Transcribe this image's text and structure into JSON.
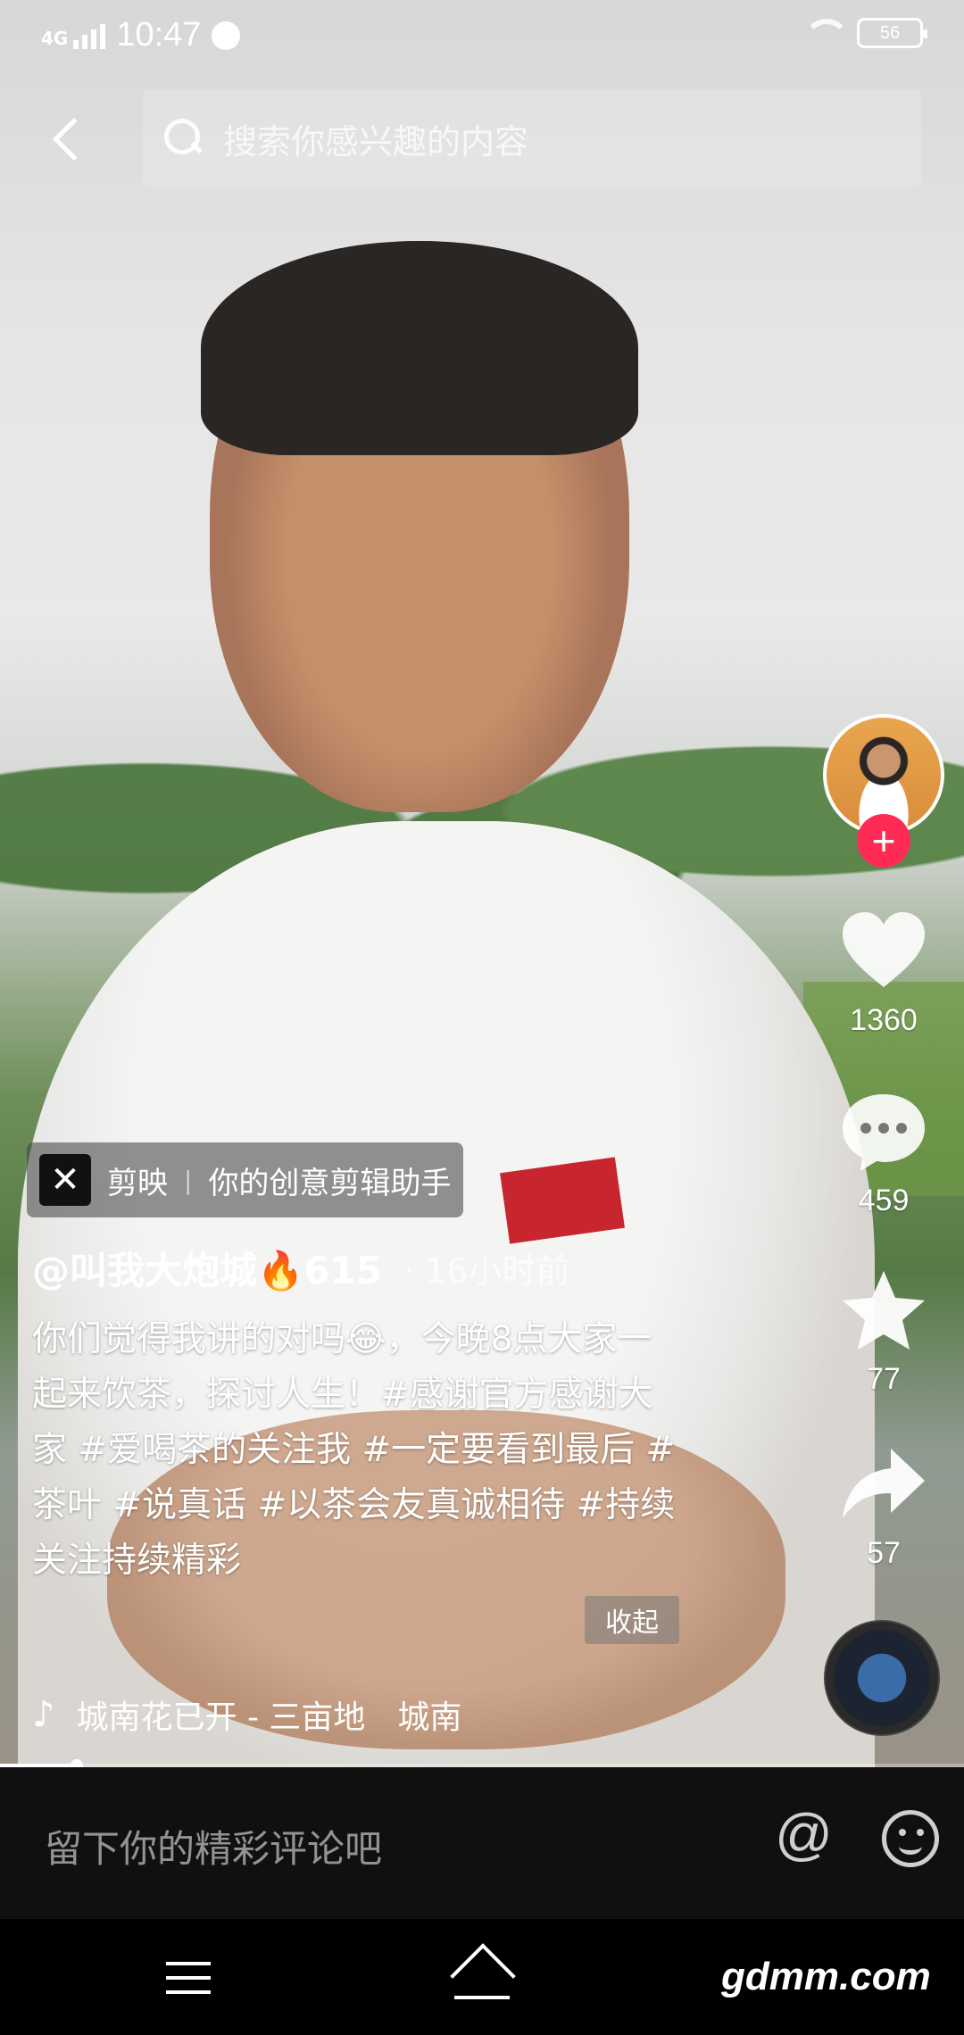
{
  "status_bar": {
    "network": "4G",
    "time": "10:47",
    "battery": "56"
  },
  "search": {
    "placeholder": "搜索你感兴趣的内容"
  },
  "rail": {
    "likes": "1360",
    "comments": "459",
    "favorites": "77",
    "shares": "57",
    "follow_symbol": "+"
  },
  "capcut": {
    "brand": "剪映",
    "separator": "|",
    "slogan": "你的创意剪辑助手"
  },
  "post": {
    "author": "@叫我大炮城🔥615",
    "time_ago": "· 16小时前",
    "caption": "你们觉得我讲的对吗😂，今晚8点大家一起来饮茶，探讨人生！#感谢官方感谢大家 #爱喝茶的关注我 #一定要看到最后 #茶叶 #说真话 #以茶会友真诚相待 #持续关注持续精彩",
    "collapse": "收起"
  },
  "music": {
    "title": "城南花已开 - 三亩地　城南"
  },
  "progress": {
    "fraction": 0.08
  },
  "comment_bar": {
    "placeholder": "留下你的精彩评论吧",
    "at_symbol": "@"
  },
  "nav": {
    "watermark": "gdmm.com"
  },
  "colors": {
    "accent": "#fe2c55",
    "comment_bar_bg": "#101010"
  }
}
